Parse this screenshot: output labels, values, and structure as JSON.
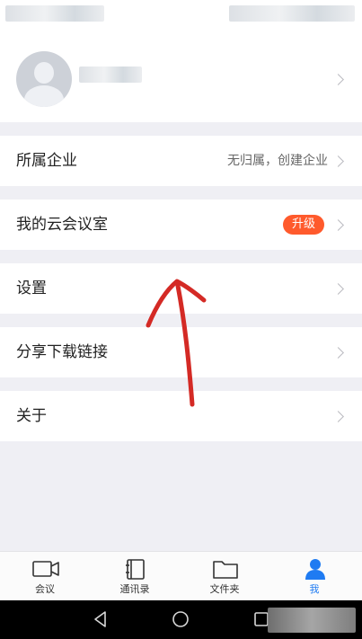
{
  "menu": {
    "items": [
      {
        "label": "所属企业",
        "value": "无归属，创建企业"
      },
      {
        "label": "我的云会议室",
        "badge": "升级"
      },
      {
        "label": "设置"
      },
      {
        "label": "分享下载链接"
      },
      {
        "label": "关于"
      }
    ]
  },
  "tabbar": {
    "tabs": [
      {
        "label": "会议",
        "icon": "video-camera-icon"
      },
      {
        "label": "通讯录",
        "icon": "contacts-book-icon"
      },
      {
        "label": "文件夹",
        "icon": "folder-icon"
      },
      {
        "label": "我",
        "icon": "person-icon",
        "active": true
      }
    ]
  },
  "colors": {
    "accent": "#1f7bf2",
    "badge": "#ff5a2c",
    "annotation": "#d42a25",
    "background": "#efeff4"
  },
  "system_nav": {
    "icons": [
      "back-icon",
      "home-icon",
      "recents-icon"
    ]
  }
}
